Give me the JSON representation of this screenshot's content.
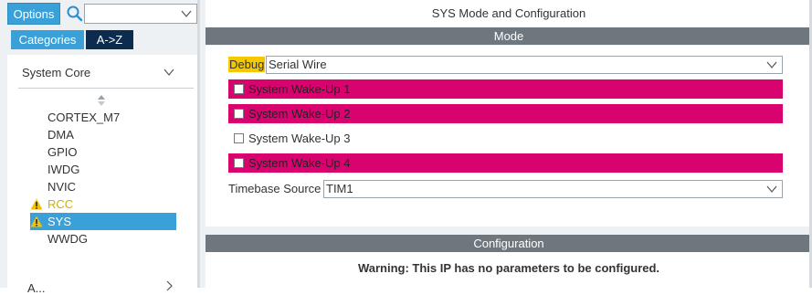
{
  "left_panel": {
    "options_label": "Options",
    "tabs": [
      {
        "label": "Categories"
      },
      {
        "label": "A->Z"
      }
    ],
    "group_label": "System Core",
    "items": [
      {
        "label": "CORTEX_M7"
      },
      {
        "label": "DMA"
      },
      {
        "label": "GPIO"
      },
      {
        "label": "IWDG"
      },
      {
        "label": "NVIC"
      },
      {
        "label": "RCC"
      },
      {
        "label": "SYS"
      },
      {
        "label": "WWDG"
      }
    ],
    "next_group_label": "A..."
  },
  "main": {
    "title": "SYS Mode and Configuration",
    "mode_header": "Mode",
    "debug_label": "Debug",
    "debug_value": "Serial Wire",
    "wakeups": [
      {
        "label": "System Wake-Up 1"
      },
      {
        "label": "System Wake-Up 2"
      },
      {
        "label": "System Wake-Up 3"
      },
      {
        "label": "System Wake-Up 4"
      }
    ],
    "timebase_label": "Timebase Source",
    "timebase_value": "TIM1",
    "config_header": "Configuration",
    "config_warning": "Warning: This IP has no parameters to be configured."
  },
  "colors": {
    "accent": "#39a0d8",
    "dark_tab": "#0d2b4e",
    "section_bar": "#6f777e",
    "highlight_row": "#d8036f",
    "debug_highlight": "#f5c800",
    "warn_icon": "#f2c200"
  },
  "icons": [
    "search-icon",
    "chevron-down-icon",
    "sort-icon",
    "warning-icon"
  ]
}
